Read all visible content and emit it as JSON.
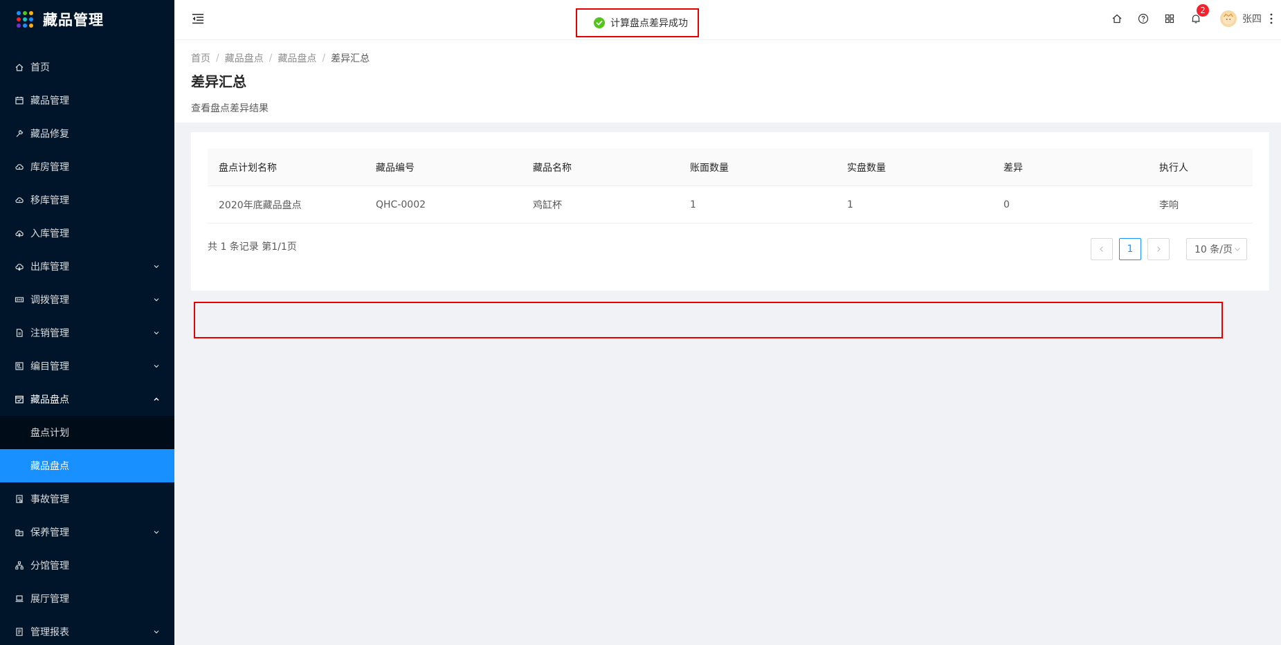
{
  "app": {
    "title": "藏品管理",
    "logo_colors": [
      "#1890ff",
      "#52c41a",
      "#faad14",
      "#f5222d",
      "#13c2c2",
      "#1890ff",
      "#722ed1",
      "#1890ff",
      "#faad14"
    ]
  },
  "sidebar": {
    "items": [
      {
        "label": "首页",
        "icon": "home-icon",
        "has_arrow": false
      },
      {
        "label": "藏品管理",
        "icon": "calendar-icon",
        "has_arrow": false
      },
      {
        "label": "藏品修复",
        "icon": "wrench-icon",
        "has_arrow": false
      },
      {
        "label": "库房管理",
        "icon": "cloud-icon",
        "has_arrow": false
      },
      {
        "label": "移库管理",
        "icon": "cloud-sync-icon",
        "has_arrow": false
      },
      {
        "label": "入库管理",
        "icon": "cloud-upload-icon",
        "has_arrow": false
      },
      {
        "label": "出库管理",
        "icon": "cloud-download-icon",
        "has_arrow": true
      },
      {
        "label": "调拨管理",
        "icon": "transfer-icon",
        "has_arrow": true
      },
      {
        "label": "注销管理",
        "icon": "file-icon",
        "has_arrow": true
      },
      {
        "label": "编目管理",
        "icon": "catalog-icon",
        "has_arrow": true
      },
      {
        "label": "藏品盘点",
        "icon": "inventory-icon",
        "has_arrow": true,
        "open": true
      },
      {
        "label": "盘点计划",
        "sub": true
      },
      {
        "label": "藏品盘点",
        "sub": true,
        "active": true
      },
      {
        "label": "事故管理",
        "icon": "report-icon",
        "has_arrow": false
      },
      {
        "label": "保养管理",
        "icon": "building-icon",
        "has_arrow": true
      },
      {
        "label": "分馆管理",
        "icon": "cluster-icon",
        "has_arrow": false
      },
      {
        "label": "展厅管理",
        "icon": "laptop-icon",
        "has_arrow": false
      },
      {
        "label": "管理报表",
        "icon": "form-icon",
        "has_arrow": true
      }
    ]
  },
  "toast": {
    "message": "计算盘点差异成功",
    "color": "#52c41a"
  },
  "header": {
    "notification_count": "2",
    "user_name": "张四"
  },
  "breadcrumb": {
    "items": [
      "首页",
      "藏品盘点",
      "藏品盘点"
    ],
    "current": "差异汇总"
  },
  "page": {
    "title": "差异汇总",
    "description": "查看盘点差异结果"
  },
  "table": {
    "columns": [
      "盘点计划名称",
      "藏品编号",
      "藏品名称",
      "账面数量",
      "实盘数量",
      "差异",
      "执行人"
    ],
    "rows": [
      [
        "2020年底藏品盘点",
        "QHC-0002",
        "鸡缸杯",
        "1",
        "1",
        "0",
        "李响"
      ]
    ]
  },
  "pagination": {
    "total_text": "共 1 条记录 第1/1页",
    "current_page": "1",
    "page_size": "10 条/页"
  },
  "colors": {
    "primary": "#1890ff",
    "sidebar_bg": "#001529",
    "highlight": "#e60000"
  }
}
